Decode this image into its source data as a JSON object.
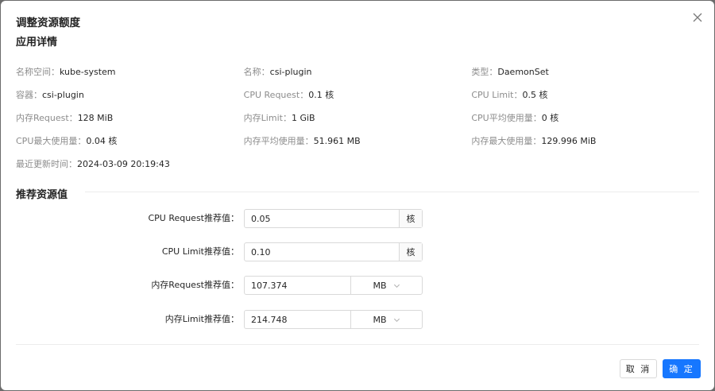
{
  "modal": {
    "title": "调整资源额度",
    "close_icon": "close-icon"
  },
  "details": {
    "title": "应用详情",
    "rows": [
      [
        {
          "label": "名称空间：",
          "value": "kube-system"
        },
        {
          "label": "名称：",
          "value": "csi-plugin"
        },
        {
          "label": "类型：",
          "value": "DaemonSet"
        }
      ],
      [
        {
          "label": "容器：",
          "value": "csi-plugin"
        },
        {
          "label": "CPU Request：",
          "value": "0.1 核"
        },
        {
          "label": "CPU Limit：",
          "value": "0.5 核"
        }
      ],
      [
        {
          "label": "内存Request：",
          "value": "128 MiB"
        },
        {
          "label": "内存Limit：",
          "value": "1 GiB"
        },
        {
          "label": "CPU平均使用量：",
          "value": "0 核"
        }
      ],
      [
        {
          "label": "CPU最大使用量：",
          "value": "0.04 核"
        },
        {
          "label": "内存平均使用量：",
          "value": "51.961 MB"
        },
        {
          "label": "内存最大使用量：",
          "value": "129.996 MiB"
        }
      ],
      [
        {
          "label": "最近更新时间：",
          "value": "2024-03-09 20:19:43"
        }
      ]
    ]
  },
  "recommend": {
    "title": "推荐资源值",
    "fields": [
      {
        "label": "CPU Request推荐值：",
        "value": "0.05",
        "unit": "核",
        "unit_type": "addon"
      },
      {
        "label": "CPU Limit推荐值：",
        "value": "0.10",
        "unit": "核",
        "unit_type": "addon"
      },
      {
        "label": "内存Request推荐值：",
        "value": "107.374",
        "unit": "MB",
        "unit_type": "select"
      },
      {
        "label": "内存Limit推荐值：",
        "value": "214.748",
        "unit": "MB",
        "unit_type": "select"
      }
    ]
  },
  "footer": {
    "cancel_label": "取 消",
    "ok_label": "确 定",
    "ok_color": "#1677ff"
  }
}
